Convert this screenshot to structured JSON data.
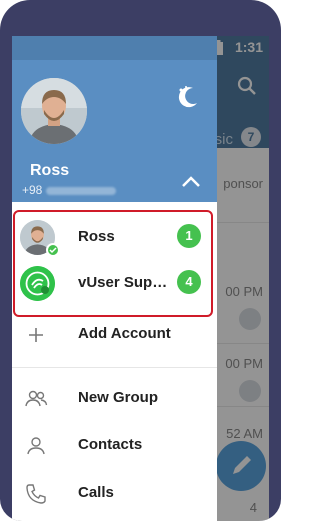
{
  "status": {
    "time": "1:31"
  },
  "user": {
    "name": "Ross",
    "phone_prefix": "+98"
  },
  "accounts": [
    {
      "name": "Ross",
      "badge": "1"
    },
    {
      "name": "vUser Sup…",
      "badge": "4"
    }
  ],
  "add_account": "Add Account",
  "menu": [
    {
      "label": "New Group",
      "icon": "group-icon"
    },
    {
      "label": "Contacts",
      "icon": "person-icon"
    },
    {
      "label": "Calls",
      "icon": "phone-icon"
    }
  ],
  "background_list": {
    "tab_partial": "sic",
    "tab_count": "7",
    "rows": [
      "ponsor",
      "00 PM",
      "00 PM",
      "52 AM",
      "4"
    ]
  },
  "colors": {
    "header": "#5a8ec2",
    "badge": "#45c14f",
    "highlight_border": "#d01b29"
  }
}
